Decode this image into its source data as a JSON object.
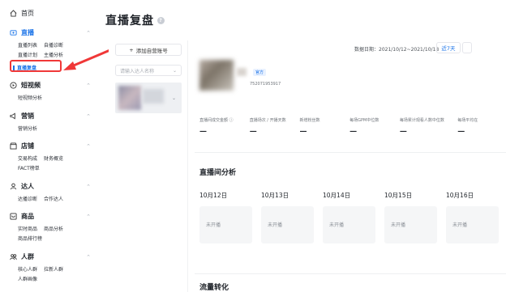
{
  "sidebar": {
    "home": "首页",
    "live": {
      "title": "直播",
      "subs": [
        [
          "直播列表",
          "自播诊断"
        ],
        [
          "直播计划",
          "主播分析"
        ]
      ],
      "active": "直播复盘"
    },
    "shortvideo": {
      "title": "短视频",
      "subs": [
        "短视频分析"
      ]
    },
    "marketing": {
      "title": "营销",
      "subs": [
        "营销分析"
      ]
    },
    "store": {
      "title": "店铺",
      "subs": [
        [
          "交易构成",
          "财务概览"
        ],
        [
          "FACT榜单"
        ]
      ]
    },
    "talent": {
      "title": "达人",
      "subs": [
        [
          "达播诊断",
          "合作达人"
        ]
      ]
    },
    "product": {
      "title": "商品",
      "subs": [
        [
          "实时商品",
          "商品分析"
        ],
        [
          "商品排行榜"
        ]
      ]
    },
    "audience": {
      "title": "人群",
      "subs": [
        [
          "核心人群",
          "拉新人群"
        ],
        [
          "人群画像"
        ]
      ]
    }
  },
  "page": {
    "title": "直播复盘"
  },
  "panel": {
    "add_button": "添加自营账号",
    "filter_placeholder": "请输入达人名称"
  },
  "header": {
    "date_label": "数据日期：2021/10/12~2021/10/18",
    "range_button": "近7天"
  },
  "account": {
    "official_badge": "官方",
    "id": "752071953917"
  },
  "metrics": [
    {
      "label": "直播间成交金额 ⓘ",
      "value": "—"
    },
    {
      "label": "直播场次 / 开播天数",
      "value": "—"
    },
    {
      "label": "新增粉丝数",
      "value": "—"
    },
    {
      "label": "每场GPM中位数",
      "value": "—"
    },
    {
      "label": "每场累计观看人数中位数",
      "value": "—"
    },
    {
      "label": "每场平均在",
      "value": "—"
    }
  ],
  "live_analysis": {
    "title": "直播间分析",
    "days": [
      {
        "date": "10月12日",
        "status": "未开播"
      },
      {
        "date": "10月13日",
        "status": "未开播"
      },
      {
        "date": "10月14日",
        "status": "未开播"
      },
      {
        "date": "10月15日",
        "status": "未开播"
      },
      {
        "date": "10月16日",
        "status": "未开播"
      }
    ]
  },
  "bottom": {
    "title": "流量转化"
  },
  "colors": {
    "accent": "#1a73e8",
    "highlight": "#f03838"
  }
}
